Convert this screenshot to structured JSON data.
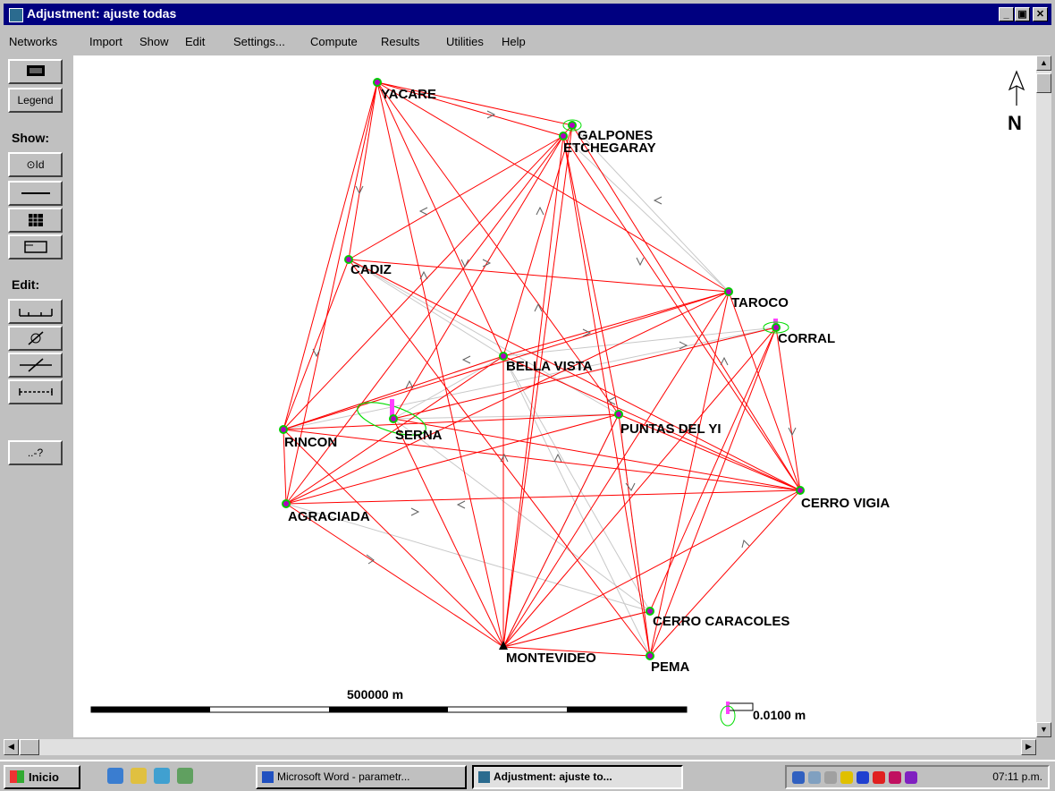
{
  "window": {
    "title": "Adjustment: ajuste todas",
    "min": "_",
    "max": "▣",
    "close": "✕"
  },
  "menu": [
    "Networks",
    "Import",
    "Show",
    "Edit",
    "Settings...",
    "Compute",
    "Results",
    "Utilities",
    "Help"
  ],
  "toolbar": {
    "legend_label": "Legend",
    "show_label": "Show:",
    "id_label": "⊙Id",
    "edit_label": "Edit:",
    "help_label": "..-?"
  },
  "map": {
    "north_label": "N",
    "stations": [
      "YACARE",
      "GALPONES",
      "ETCHEGARAY",
      "CADIZ",
      "TAROCO",
      "CORRAL",
      "BELLA VISTA",
      "SERNA",
      "RINCON",
      "PUNTAS DEL YI",
      "CERRO VIGIA",
      "AGRACIADA",
      "CERRO CARACOLES",
      "MONTEVIDEO",
      "PEMA"
    ],
    "scale_label": "500000 m",
    "ellipse_scale_label": "0.0100 m",
    "colors": {
      "observation": "#ff0000",
      "unused": "#c8c8c8",
      "ellipse": "#00dd00",
      "station": "#b000c0",
      "vector": "#ff40ff"
    }
  },
  "taskbar": {
    "start_label": "Inicio",
    "tasks": [
      "Microsoft Word - parametr...",
      "Adjustment: ajuste to..."
    ],
    "clock": "07:11 p.m."
  }
}
